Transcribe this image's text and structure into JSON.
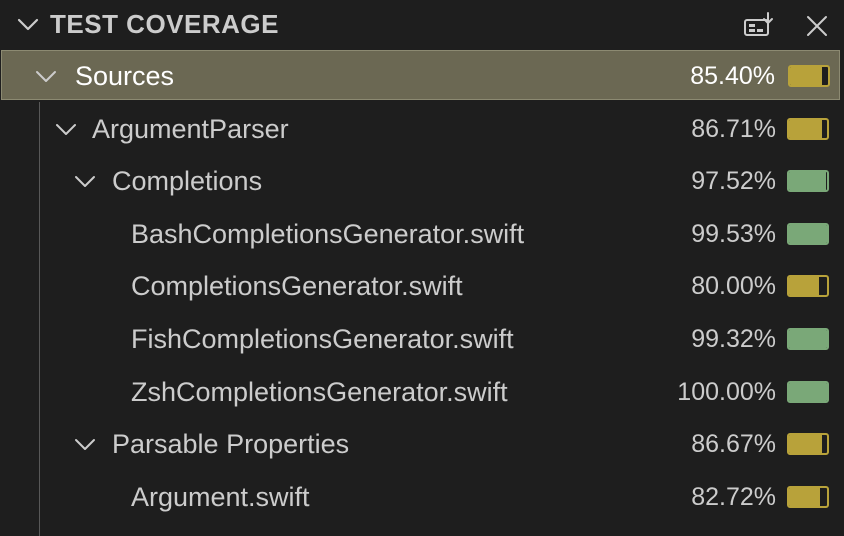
{
  "panel": {
    "title": "TEST COVERAGE"
  },
  "tree": [
    {
      "label": "Sources",
      "percent": "85.40%",
      "coverage": 0.854,
      "level": 0,
      "expanded": true,
      "selected": true
    },
    {
      "label": "ArgumentParser",
      "percent": "86.71%",
      "coverage": 0.8671,
      "level": 1,
      "expanded": true,
      "selected": false
    },
    {
      "label": "Completions",
      "percent": "97.52%",
      "coverage": 0.9752,
      "level": 2,
      "expanded": true,
      "selected": false
    },
    {
      "label": "BashCompletionsGenerator.swift",
      "percent": "99.53%",
      "coverage": 0.9953,
      "level": 3,
      "expanded": null,
      "selected": false
    },
    {
      "label": "CompletionsGenerator.swift",
      "percent": "80.00%",
      "coverage": 0.8,
      "level": 3,
      "expanded": null,
      "selected": false
    },
    {
      "label": "FishCompletionsGenerator.swift",
      "percent": "99.32%",
      "coverage": 0.9932,
      "level": 3,
      "expanded": null,
      "selected": false
    },
    {
      "label": "ZshCompletionsGenerator.swift",
      "percent": "100.00%",
      "coverage": 1.0,
      "level": 3,
      "expanded": null,
      "selected": false
    },
    {
      "label": "Parsable Properties",
      "percent": "86.67%",
      "coverage": 0.8667,
      "level": 2,
      "expanded": true,
      "selected": false
    },
    {
      "label": "Argument.swift",
      "percent": "82.72%",
      "coverage": 0.8272,
      "level": 3,
      "expanded": null,
      "selected": false
    }
  ],
  "colors": {
    "high_coverage": "#7aa878",
    "medium_coverage": "#b8a23a",
    "selected_bg": "#6b6853"
  },
  "icons": {
    "header_twistie": "chevron-down-icon",
    "action_1": "view-as-list-icon",
    "action_2": "close-icon"
  }
}
